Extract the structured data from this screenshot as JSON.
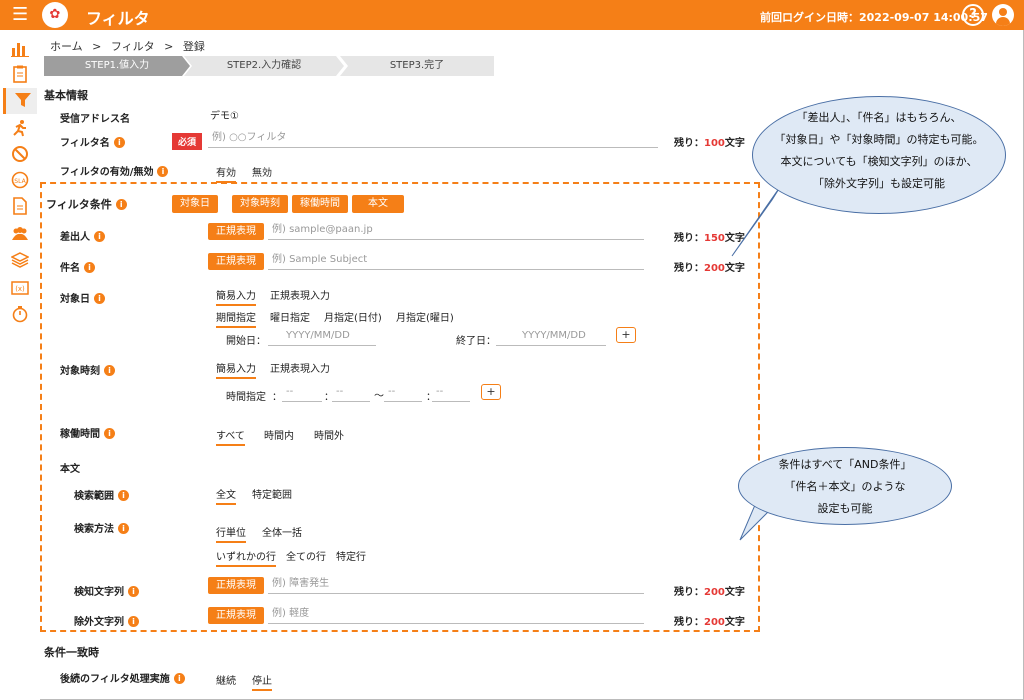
{
  "header": {
    "menu_icon": "hamburger-icon",
    "logo": "app-logo",
    "title": "フィルタ",
    "last_login": "前回ログイン日時：2022-09-07 14:00:57",
    "help": "?"
  },
  "breadcrumb": [
    "ホーム",
    ">",
    "フィルタ",
    ">",
    "登録"
  ],
  "steps": [
    "STEP1.値入力",
    "STEP2.入力確認",
    "STEP3.完了"
  ],
  "basic": {
    "section": "基本情報",
    "address_label": "受信アドレス名",
    "address_value": "デモ①",
    "filter_name_label": "フィルタ名",
    "required": "必須",
    "filter_name_placeholder": "例) ○○フィルタ",
    "remain_prefix": "残り：",
    "remain_100": "100",
    "remain_suffix": "文字",
    "enable_label": "フィルタの有効/無効",
    "enable_on": "有効",
    "enable_off": "無効"
  },
  "conditions": {
    "label": "フィルタ条件",
    "buttons": [
      "対象日",
      "対象時刻",
      "稼働時間",
      "本文"
    ],
    "regex": "正規表現",
    "sender_label": "差出人",
    "sender_placeholder": "例) sample@paan.jp",
    "remain_150": "150",
    "subject_label": "件名",
    "subject_placeholder": "例) Sample Subject",
    "remain_200": "200",
    "date_label": "対象日",
    "simple": "簡易入力",
    "regex_input": "正規表現入力",
    "date_modes": [
      "期間指定",
      "曜日指定",
      "月指定(日付)",
      "月指定(曜日)"
    ],
    "start_label": "開始日：",
    "start_ph": "YYYY/MM/DD",
    "end_label": "終了日：",
    "end_ph": "YYYY/MM/DD",
    "plus": "+",
    "time_label": "対象時刻",
    "time_spec": "時間指定",
    "colon": "：",
    "dash": "--",
    "tilde": "〜",
    "hours_label": "稼働時間",
    "hours_modes": [
      "すべて",
      "時間内",
      "時間外"
    ],
    "body_label": "本文",
    "range_label": "検索範囲",
    "range_modes": [
      "全文",
      "特定範囲"
    ],
    "method_label": "検索方法",
    "method_modes": [
      "行単位",
      "全体一括"
    ],
    "line_modes": [
      "いずれかの行",
      "全ての行",
      "特定行"
    ],
    "detect_label": "検知文字列",
    "detect_ph": "例) 障害発生",
    "exclude_label": "除外文字列",
    "exclude_ph": "例) 軽度"
  },
  "match": {
    "section": "条件一致時",
    "subsequent_label": "後続のフィルタ処理実施",
    "modes": [
      "継続",
      "停止"
    ]
  },
  "callouts": {
    "top": [
      "「差出人」、「件名」はもちろん、",
      "「対象日」や「対象時間」の特定も可能。",
      "本文についても「検知文字列」のほか、",
      "「除外文字列」も設定可能"
    ],
    "bottom": [
      "条件はすべて「AND条件」",
      "「件名＋本文」のような",
      "設定も可能"
    ]
  },
  "colors": {
    "accent": "#f57f17",
    "required": "#e53935",
    "callout": "#dfe9f5"
  }
}
